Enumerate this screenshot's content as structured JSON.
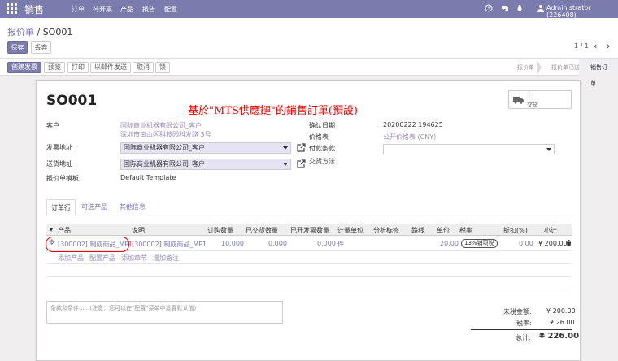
{
  "nav": {
    "brand": "销售",
    "menu": [
      "订单",
      "待开票",
      "产品",
      "报告",
      "配置"
    ],
    "user": "Administrator (226408)"
  },
  "control": {
    "breadcrumb_parent": "报价单",
    "breadcrumb_sep": " / ",
    "breadcrumb_current": "SO001",
    "save": "保存",
    "discard": "丢弃",
    "pager": "1 / 1"
  },
  "statusbar": {
    "buttons": [
      "创建发票",
      "预览",
      "打印",
      "以邮件发送",
      "取消",
      "锁"
    ],
    "stages": [
      "报价单",
      "报价单已送出",
      "销售订单"
    ]
  },
  "sheet": {
    "title": "SO001",
    "annotation": "基於\"MTS供應鏈\"的銷售訂單(預設)",
    "smart_button": {
      "count": "1",
      "label": "交货"
    },
    "fields": {
      "customer_label": "客户",
      "customer_name": "国际商业机器有限公司_客户",
      "customer_address": "深圳市南山区科技园科发路 3号",
      "invoice_addr_label": "发票地址",
      "invoice_addr_value": "国际商业机器有限公司_客户",
      "delivery_addr_label": "送货地址",
      "delivery_addr_value": "国际商业机器有限公司_客户",
      "template_label": "报价单模板",
      "template_value": "Default Template",
      "confirm_date_label": "确认日期",
      "confirm_date_value": "20200222 194625",
      "pricelist_label": "价格表",
      "pricelist_value": "公开价格表 (CNY)",
      "payment_terms_label": "付款条款",
      "delivery_method_label": "交货方法"
    },
    "tabs": [
      "订单行",
      "可选产品",
      "其他信息"
    ],
    "table": {
      "headers": [
        "产品",
        "说明",
        "订购数量",
        "已交货数量",
        "已开发票数量",
        "计量单位",
        "分析标签",
        "路线",
        "单价",
        "税率",
        "折扣(%)",
        "小计"
      ],
      "row": {
        "product": "[300002] 制成商品_MP1",
        "description": "[300002] 制成商品_MP1",
        "qty": "10.000",
        "delivered": "0.000",
        "invoiced": "0.000",
        "uom": "件",
        "unit_price": "20.00",
        "tax": "13%销项税",
        "discount": "0.00",
        "subtotal": "¥ 200.00"
      },
      "add_links": [
        "添加产品",
        "配置产品",
        "添加章节",
        "增加备注"
      ]
    },
    "notes_placeholder": "条款和条件......(注意：您可以在\"配置\"菜单中设置默认值)",
    "totals": {
      "untaxed_label": "未税金额:",
      "untaxed_value": "¥ 200.00",
      "tax_label": "税率:",
      "tax_value": "¥ 26.00",
      "total_label": "总计:",
      "total_value": "¥ 226.00"
    }
  },
  "colors": {
    "brand": "#7c7bad",
    "link": "#9a8cba",
    "annotation": "#ee0000"
  }
}
